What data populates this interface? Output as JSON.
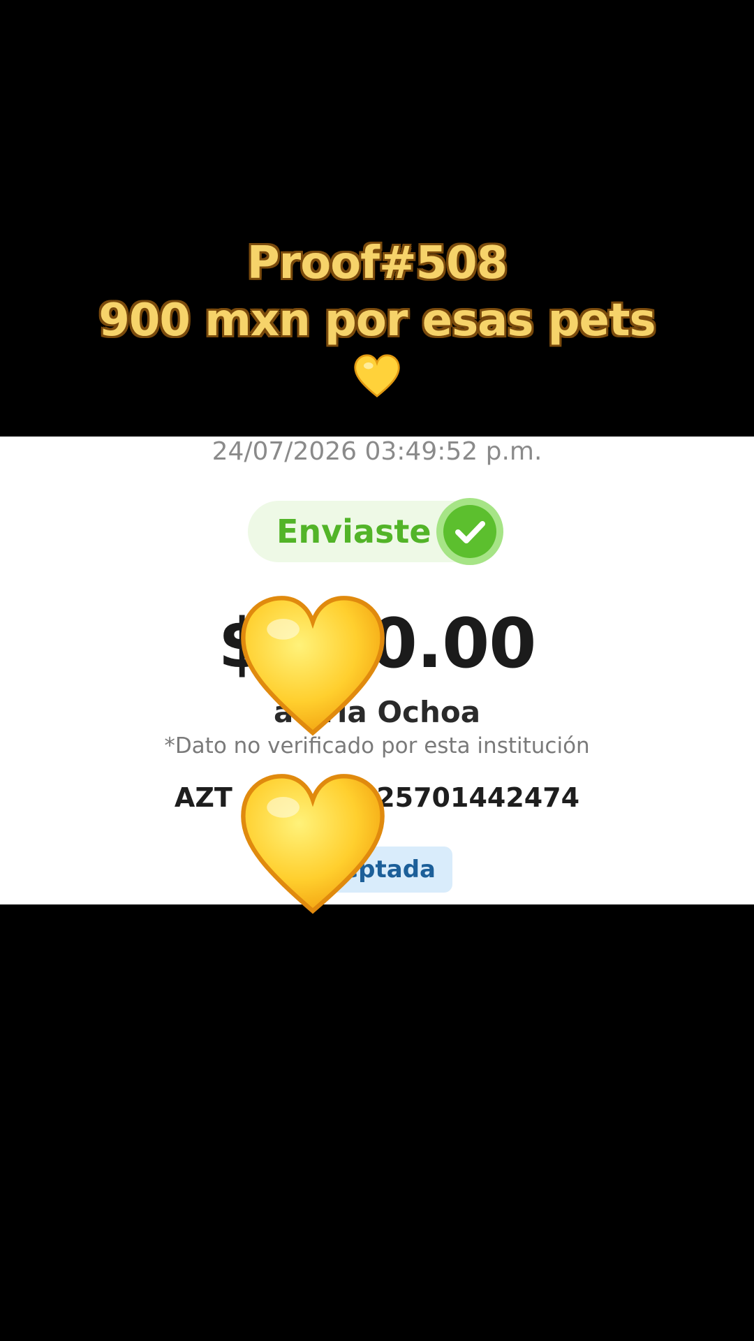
{
  "caption": {
    "line1": "Proof#508",
    "line2": "900 mxn por esas pets",
    "emoji": "yellow-heart"
  },
  "receipt": {
    "timestamp": "24/07/2026 03:49:52 p.m.",
    "status_label": "Enviaste",
    "status_icon": "check-circle-icon",
    "amount_prefix": "$",
    "amount_suffix": "0.00",
    "recipient_prefix": "a",
    "recipient_suffix": "rla Ochoa",
    "disclaimer": "*Dato no verificado por esta institución",
    "tracking_prefix": "AZT",
    "tracking_suffix": "225701442474",
    "badge_label": "eptada"
  },
  "overlay": {
    "stickers": [
      "yellow-heart",
      "yellow-heart"
    ]
  },
  "colors": {
    "background": "#000000",
    "caption_fill": "#f6d36a",
    "caption_outline": "#7a4a0c",
    "success_green": "#52b428",
    "badge_bg": "#d9ecfb",
    "badge_text": "#1c5f99"
  }
}
